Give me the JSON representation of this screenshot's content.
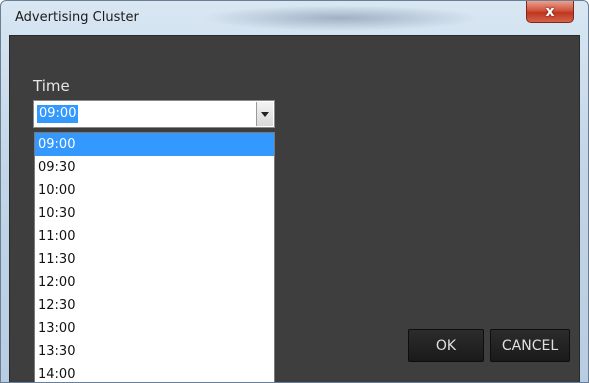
{
  "window": {
    "title": "Advertising Cluster",
    "close_label": "x"
  },
  "time_field": {
    "label": "Time",
    "selected_value": "09:00",
    "options": [
      "09:00",
      "09:30",
      "10:00",
      "10:30",
      "11:00",
      "11:30",
      "12:00",
      "12:30",
      "13:00",
      "13:30",
      "14:00"
    ]
  },
  "buttons": {
    "ok_label": "OK",
    "cancel_label": "CANCEL"
  },
  "colors": {
    "selection": "#3399ff",
    "content_background": "#3e3e3e",
    "button_background": "#1a1a1a"
  },
  "icons": {
    "close": "close-icon",
    "dropdown": "chevron-down-icon"
  }
}
